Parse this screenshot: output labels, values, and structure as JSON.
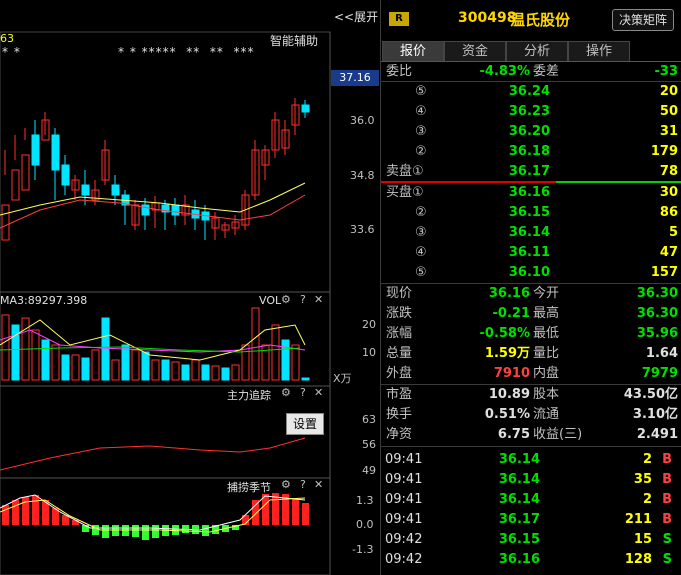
{
  "chart": {
    "expand_label": "<<展开",
    "indicator_title": "智能辅助",
    "corner_value": "63",
    "star_rows": [
      "* *",
      "* * *****  **  **  ***"
    ],
    "current_price_tag": "37.16",
    "price_axis": [
      "36.0",
      "34.8",
      "33.6"
    ],
    "ma_label": "MA3:89297.398",
    "vol_title": "VOL",
    "vol_axis": [
      "20",
      "10"
    ],
    "vol_unit": "X万",
    "zl_title": "主力追踪",
    "zl_axis": [
      "63",
      "56",
      "49"
    ],
    "settings_label": "设置",
    "season_title": "捕捞季节",
    "season_axis": [
      "1.3",
      "0.0",
      "-1.3"
    ],
    "icons": {
      "gear": "⚙",
      "help": "?",
      "close": "✕"
    }
  },
  "header": {
    "badge": "R",
    "code": "300498",
    "name": "温氏股份",
    "decide_button": "决策矩阵"
  },
  "tabs": [
    {
      "label": "报价",
      "active": true
    },
    {
      "label": "资金",
      "active": false
    },
    {
      "label": "分析",
      "active": false
    },
    {
      "label": "操作",
      "active": false
    }
  ],
  "order_book": {
    "weibi_label": "委比",
    "weibi_value": "-4.83%",
    "weicha_label": "委差",
    "weicha_value": "-33",
    "sells": [
      {
        "lvl": "⑤",
        "price": "36.24",
        "vol": "20"
      },
      {
        "lvl": "④",
        "price": "36.23",
        "vol": "50"
      },
      {
        "lvl": "③",
        "price": "36.20",
        "vol": "31"
      },
      {
        "lvl": "②",
        "price": "36.18",
        "vol": "179"
      },
      {
        "lvl": "卖盘①",
        "price": "36.17",
        "vol": "78"
      }
    ],
    "buys": [
      {
        "lvl": "买盘①",
        "price": "36.16",
        "vol": "30"
      },
      {
        "lvl": "②",
        "price": "36.15",
        "vol": "86"
      },
      {
        "lvl": "③",
        "price": "36.14",
        "vol": "5"
      },
      {
        "lvl": "④",
        "price": "36.11",
        "vol": "47"
      },
      {
        "lvl": "⑤",
        "price": "36.10",
        "vol": "157"
      }
    ]
  },
  "quote": [
    {
      "l1": "现价",
      "v1": "36.16",
      "c1": "green",
      "l2": "今开",
      "v2": "36.30",
      "c2": "green"
    },
    {
      "l1": "涨跌",
      "v1": "-0.21",
      "c1": "green",
      "l2": "最高",
      "v2": "36.30",
      "c2": "green"
    },
    {
      "l1": "涨幅",
      "v1": "-0.58%",
      "c1": "green",
      "l2": "最低",
      "v2": "35.96",
      "c2": "green"
    },
    {
      "l1": "总量",
      "v1": "1.59万",
      "c1": "yellow",
      "l2": "量比",
      "v2": "1.64",
      "c2": "white"
    },
    {
      "l1": "外盘",
      "v1": "7910",
      "c1": "red",
      "l2": "内盘",
      "v2": "7979",
      "c2": "green"
    }
  ],
  "fundamentals": [
    {
      "l1": "市盈",
      "v1": "10.89",
      "l2": "股本",
      "v2": "43.50亿"
    },
    {
      "l1": "换手",
      "v1": "0.51%",
      "l2": "流通",
      "v2": "3.10亿"
    },
    {
      "l1": "净资",
      "v1": "6.75",
      "l2": "收益(三)",
      "v2": "2.491"
    }
  ],
  "ticks": [
    {
      "time": "09:41",
      "price": "36.14",
      "vol": "2",
      "dir": "B"
    },
    {
      "time": "09:41",
      "price": "36.14",
      "vol": "35",
      "dir": "B"
    },
    {
      "time": "09:41",
      "price": "36.14",
      "vol": "2",
      "dir": "B"
    },
    {
      "time": "09:41",
      "price": "36.17",
      "vol": "211",
      "dir": "B"
    },
    {
      "time": "09:42",
      "price": "36.15",
      "vol": "15",
      "dir": "S"
    },
    {
      "time": "09:42",
      "price": "36.16",
      "vol": "128",
      "dir": "S"
    }
  ],
  "colors": {
    "up": "#ff3030",
    "down": "#00e5ff",
    "green": "#00e000",
    "yellow": "#ffff00",
    "bg": "#000000"
  }
}
